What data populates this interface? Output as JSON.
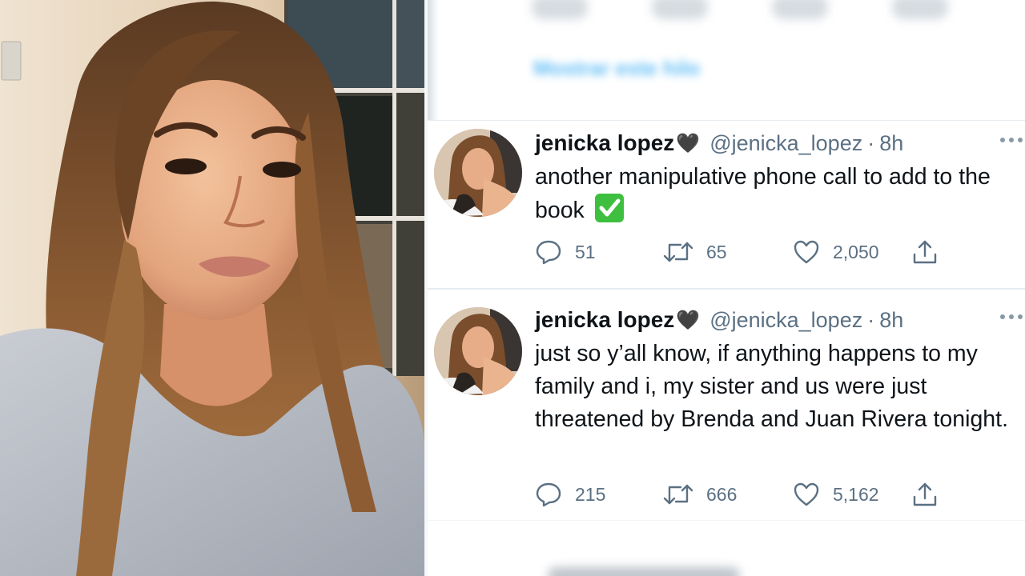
{
  "photo": {
    "subject": "selfie-photo"
  },
  "top_section": {
    "show_thread_label": "Mostrar este hilo"
  },
  "tweets": [
    {
      "name": "jenicka lopez",
      "name_emoji": "🖤",
      "handle": "@jenicka_lopez",
      "separator": "·",
      "time": "8h",
      "text": "another manipulative phone call to add to the book",
      "text_emoji": "check-mark-button-emoji",
      "replies": "51",
      "retweets": "65",
      "likes": "2,050"
    },
    {
      "name": "jenicka lopez",
      "name_emoji": "🖤",
      "handle": "@jenicka_lopez",
      "separator": "·",
      "time": "8h",
      "text": "just so y’all know, if anything happens to my family and i, my sister and us were just threatened by Brenda and Juan Rivera tonight.",
      "replies": "215",
      "retweets": "666",
      "likes": "5,162"
    }
  ],
  "colors": {
    "text_primary": "#0f1419",
    "text_secondary": "#5b7083",
    "divider": "#e6ecf0",
    "check_green": "#3fbf3f"
  },
  "icons": {
    "reply": "reply-icon",
    "retweet": "retweet-icon",
    "like": "like-icon",
    "share": "share-icon",
    "more": "more-icon"
  }
}
